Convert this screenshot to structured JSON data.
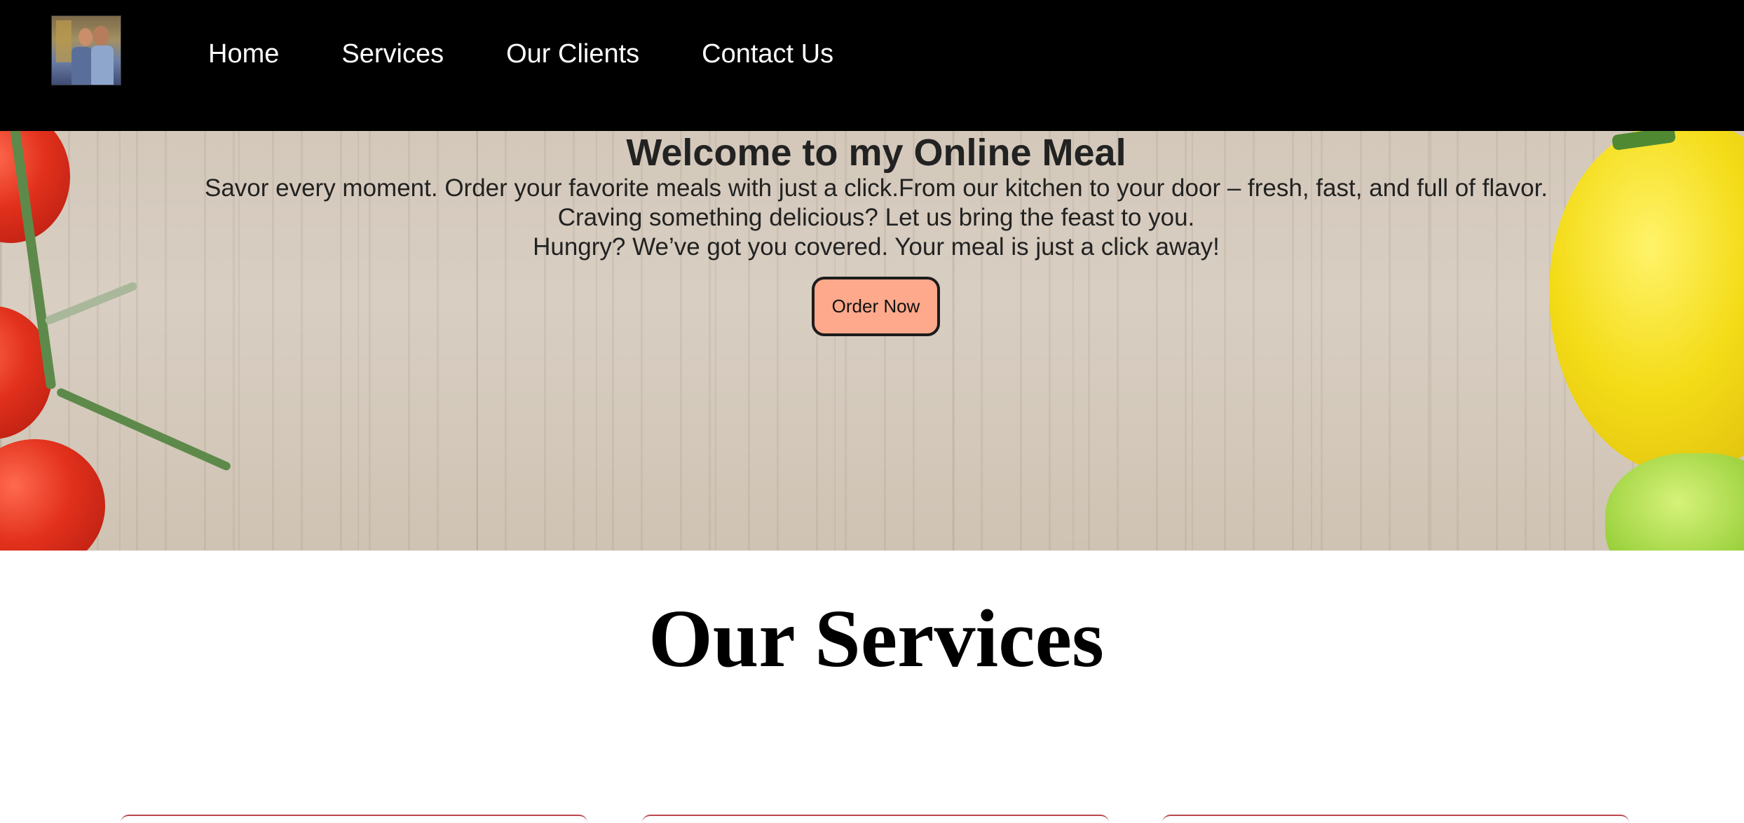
{
  "navbar": {
    "logo_alt": "profile photo",
    "links": [
      {
        "label": "Home"
      },
      {
        "label": "Services"
      },
      {
        "label": "Our Clients"
      },
      {
        "label": "Contact Us"
      }
    ]
  },
  "hero": {
    "title": "Welcome to my Online Meal",
    "lines": [
      "Savor every moment. Order your favorite meals with just a click.From our kitchen to your door – fresh, fast, and full of flavor.",
      "Craving something delicious? Let us bring the feast to you.",
      "Hungry? We’ve got you covered. Your meal is just a click away!"
    ],
    "button_label": "Order Now"
  },
  "services": {
    "title": "Our Services"
  },
  "colors": {
    "navbar_bg": "#000000",
    "button_bg": "#fea98c",
    "card_border": "#b7474f"
  }
}
